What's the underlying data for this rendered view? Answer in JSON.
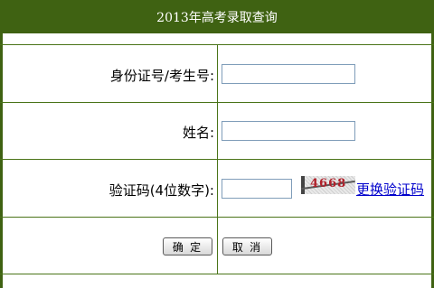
{
  "header": {
    "title": "2013年高考录取查询"
  },
  "form": {
    "id_label": "身份证号/考生号:",
    "name_label": "姓名:",
    "captcha_label": "验证码(4位数字):",
    "captcha_digits": "4668",
    "refresh_link": "更换验证码",
    "id_value": "",
    "name_value": "",
    "captcha_value": ""
  },
  "buttons": {
    "confirm": "确 定",
    "cancel": "取 消"
  },
  "colors": {
    "header_bg": "#3f6212",
    "border": "#4a7418",
    "link": "#0000cc"
  }
}
